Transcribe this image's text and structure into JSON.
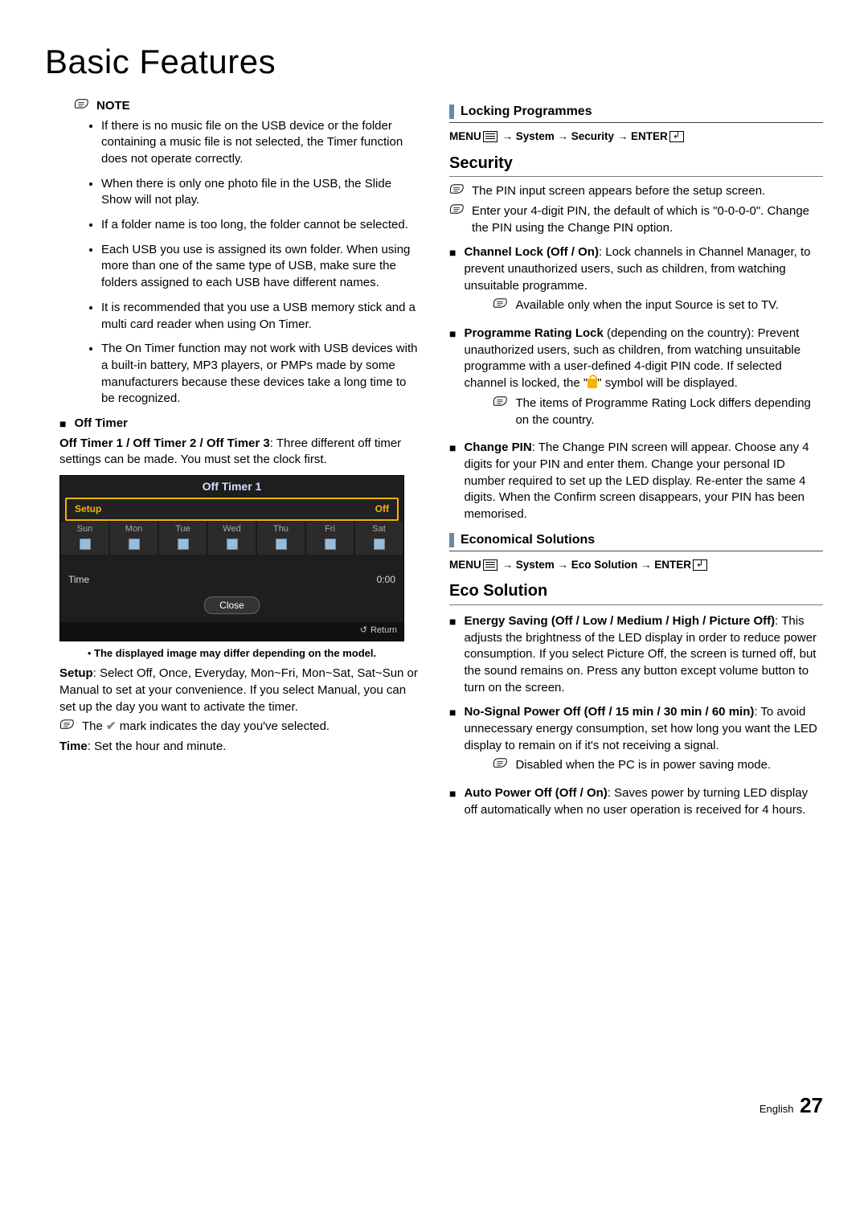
{
  "page_title": "Basic Features",
  "left": {
    "note_label": "NOTE",
    "notes": [
      "If there is no music file on the USB device or the folder containing a music file is not selected, the Timer function does not operate correctly.",
      "When there is only one photo file in the USB, the Slide Show will not play.",
      "If a folder name is too long, the folder cannot be selected.",
      "Each USB you use is assigned its own folder. When using more than one of the same type of USB, make sure the folders assigned to each USB have different names.",
      "It is recommended that you use a USB memory stick and a multi card reader when using On Timer.",
      "The On Timer function may not work with USB devices with a built-in battery, MP3 players, or PMPs made by some manufacturers because these devices take a long time to be recognized."
    ],
    "off_timer_label": "Off Timer",
    "off_timer_intro_bold": "Off Timer 1 / Off Timer 2 / Off Timer 3",
    "off_timer_intro_rest": ": Three different off timer settings can be made. You must set the clock first.",
    "timer_box": {
      "title": "Off Timer 1",
      "setup_label": "Setup",
      "setup_value": "Off",
      "days": [
        "Sun",
        "Mon",
        "Tue",
        "Wed",
        "Thu",
        "Fri",
        "Sat"
      ],
      "time_label": "Time",
      "time_value": "0:00",
      "close_label": "Close",
      "return_label": "Return"
    },
    "model_note": "The displayed image may differ depending on the model.",
    "setup_text_pre": "Setup",
    "setup_text_body": ": Select Off, Once, Everyday, Mon~Fri, Mon~Sat, Sat~Sun or Manual to set at your convenience. If you select Manual, you can set up the day you want to activate the timer.",
    "check_note": "The ✔ mark indicates the day you've selected.",
    "time_text_pre": "Time",
    "time_text_body": ": Set the hour and minute."
  },
  "right": {
    "locking_header": "Locking Programmes",
    "locking_path_pre": "MENU",
    "locking_path_mid": " → System → Security → ENTER",
    "security_header": "Security",
    "sec_note1": "The PIN input screen appears before the setup screen.",
    "sec_note2": "Enter your 4-digit PIN, the default of which is \"0-0-0-0\". Change the PIN using the Change PIN option.",
    "channel_lock_bold": "Channel Lock (Off / On)",
    "channel_lock_body": ": Lock channels in Channel Manager, to prevent unauthorized users, such as children, from watching unsuitable programme.",
    "channel_lock_sub": "Available only when the input Source is set to TV.",
    "prog_lock_bold": "Programme Rating Lock",
    "prog_lock_body1": " (depending on the country): Prevent unauthorized users, such as children, from watching unsuitable programme with a user-defined 4-digit PIN code. If selected channel is locked, the \"",
    "prog_lock_body2": "\" symbol will be displayed.",
    "prog_lock_sub": "The items of Programme Rating Lock differs depending on the country.",
    "change_pin_bold": "Change PIN",
    "change_pin_body": ": The Change PIN screen will appear. Choose any 4 digits for your PIN and enter them. Change your personal ID number required to set up the LED display. Re-enter the same 4 digits. When the Confirm screen disappears, your PIN has been memorised.",
    "eco_header": "Economical Solutions",
    "eco_path_pre": "MENU",
    "eco_path_mid": " → System → Eco Solution → ENTER",
    "eco_section_header": "Eco Solution",
    "energy_bold": "Energy Saving (Off / Low / Medium / High / Picture Off)",
    "energy_body": ": This adjusts the brightness of the LED display in order to reduce power consumption. If you select Picture Off, the screen is turned off, but the sound remains on. Press any button except volume button to turn on the screen.",
    "nosignal_bold": "No-Signal Power Off (Off / 15 min / 30 min / 60 min)",
    "nosignal_body": ": To avoid unnecessary energy consumption, set how long you want the LED display to remain on if it's not receiving a signal.",
    "nosignal_sub": "Disabled when the PC is in power saving mode.",
    "auto_bold": "Auto Power Off (Off / On)",
    "auto_body": ": Saves power by turning LED display off automatically when no user operation is received for 4 hours."
  },
  "footer": {
    "lang": "English",
    "page": "27"
  }
}
